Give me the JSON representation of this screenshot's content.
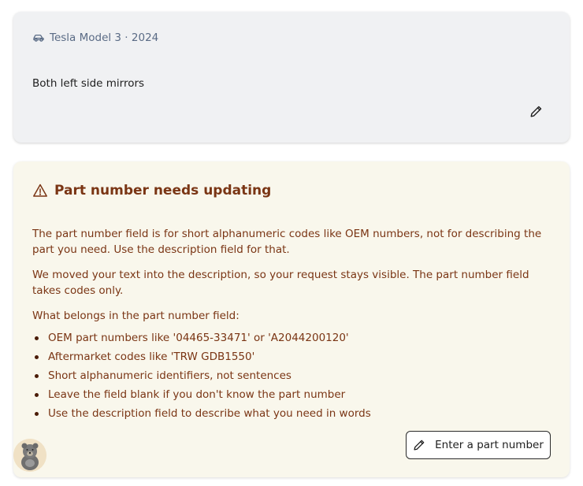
{
  "vehicle": {
    "icon": "car-icon",
    "label": "Tesla Model 3 · 2024"
  },
  "request": {
    "text": "Both left side mirrors",
    "edit_icon": "pencil-icon"
  },
  "warning": {
    "icon": "warning-triangle-icon",
    "title": "Part number needs updating",
    "paragraph1": "The part number field is for short alphanumeric codes like OEM numbers, not for describing the part you need. Use the description field for that.",
    "paragraph2": "We moved your text into the description, so your request stays visible. The part number field takes codes only.",
    "list_heading": "What belongs in the part number field:",
    "rules": [
      "OEM part numbers like '04465-33471' or 'A2044200120'",
      "Aftermarket codes like 'TRW GDB1550'",
      "Short alphanumeric identifiers, not sentences",
      "Leave the field blank if you don't know the part number",
      "Use the description field to describe what you need in words"
    ],
    "button_label": "Enter a part number",
    "button_icon": "pencil-icon"
  },
  "mascot": {
    "icon": "bear-mascot-icon"
  },
  "colors": {
    "warning_text": "#7a3514",
    "warning_bg": "#f9f7ec",
    "request_bg": "#f0f1f3",
    "vehicle_text": "#5a6b85"
  }
}
